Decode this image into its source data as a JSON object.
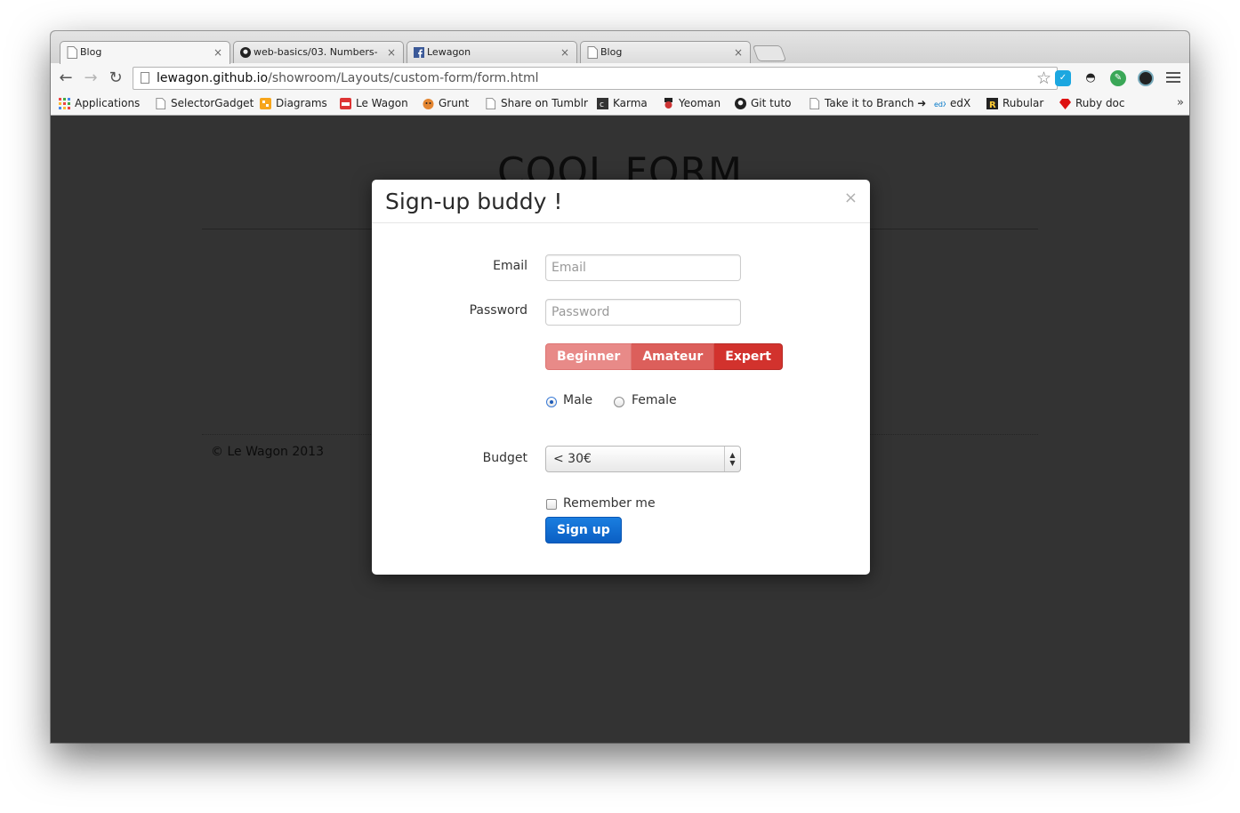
{
  "browser": {
    "tabs": [
      {
        "title": "Blog",
        "close": "×"
      },
      {
        "title": "web-basics/03. Numbers-",
        "close": "×"
      },
      {
        "title": "Lewagon",
        "close": "×"
      },
      {
        "title": "Blog",
        "close": "×"
      }
    ],
    "url": {
      "host": "lewagon.github.io",
      "path": "/showroom/Layouts/custom-form/form.html"
    },
    "star": "☆",
    "bookmarks": [
      "Applications",
      "SelectorGadget",
      "Diagrams",
      "Le Wagon",
      "Grunt",
      "Share on Tumblr",
      "Karma",
      "Yeoman",
      "Git tuto",
      "Take it to Branch ➜",
      "edX",
      "Rubular",
      "Ruby doc"
    ],
    "bookmarks_overflow": "»"
  },
  "page": {
    "title": "COOL FORM",
    "footer": "© Le Wagon 2013"
  },
  "modal": {
    "title": "Sign-up buddy !",
    "close": "×",
    "email_label": "Email",
    "email_placeholder": "Email",
    "password_label": "Password",
    "password_placeholder": "Password",
    "levels": [
      "Beginner",
      "Amateur",
      "Expert"
    ],
    "gender_options": [
      "Male",
      "Female"
    ],
    "gender_selected": "Male",
    "budget_label": "Budget",
    "budget_value": "< 30€",
    "remember_label": "Remember me",
    "remember_checked": false,
    "submit_label": "Sign up"
  },
  "colors": {
    "page_background": "#333333",
    "level_beginner": "#e88a88",
    "level_amateur": "#dc5f5b",
    "level_expert": "#d2322d",
    "submit": "#0b5fc4"
  }
}
